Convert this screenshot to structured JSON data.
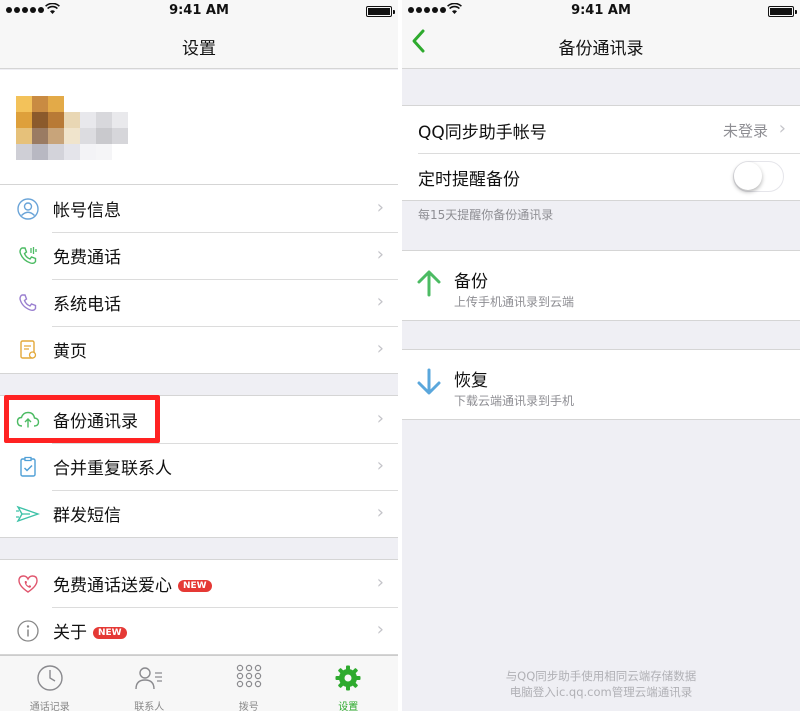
{
  "status_bar": {
    "time": "9:41 AM"
  },
  "left_screen": {
    "nav_title": "设置",
    "group1": [
      {
        "label": "帐号信息",
        "icon": "account-icon"
      },
      {
        "label": "免费通话",
        "icon": "free-call-icon"
      },
      {
        "label": "系统电话",
        "icon": "phone-icon"
      },
      {
        "label": "黄页",
        "icon": "yellow-pages-icon"
      }
    ],
    "group2": [
      {
        "label": "备份通讯录",
        "icon": "cloud-upload-icon"
      },
      {
        "label": "合并重复联系人",
        "icon": "merge-contacts-icon"
      },
      {
        "label": "群发短信",
        "icon": "mass-sms-icon"
      }
    ],
    "group3": [
      {
        "label": "免费通话送爱心",
        "badge": "NEW",
        "icon": "heart-phone-icon"
      },
      {
        "label": "关于",
        "badge": "NEW",
        "icon": "info-icon"
      }
    ],
    "tabs": [
      {
        "label": "通话记录",
        "icon": "clock-icon"
      },
      {
        "label": "联系人",
        "icon": "contacts-icon"
      },
      {
        "label": "拨号",
        "icon": "dialpad-icon"
      },
      {
        "label": "设置",
        "icon": "gear-icon",
        "active": true
      }
    ]
  },
  "right_screen": {
    "nav_title": "备份通讯录",
    "qq_account_label": "QQ同步助手帐号",
    "qq_account_value": "未登录",
    "reminder_label": "定时提醒备份",
    "reminder_on": false,
    "reminder_hint": "每15天提醒你备份通讯录",
    "backup_title": "备份",
    "backup_sub": "上传手机通讯录到云端",
    "restore_title": "恢复",
    "restore_sub": "下载云端通讯录到手机",
    "footer_line1": "与QQ同步助手使用相同云端存储数据",
    "footer_line2": "电脑登入ic.qq.com管理云端通讯录"
  },
  "colors": {
    "accent": "#2eaa2e",
    "badge": "#e53935",
    "highlight": "#ff2222",
    "up_arrow": "#4cbb63",
    "down_arrow": "#5aa7dc"
  }
}
